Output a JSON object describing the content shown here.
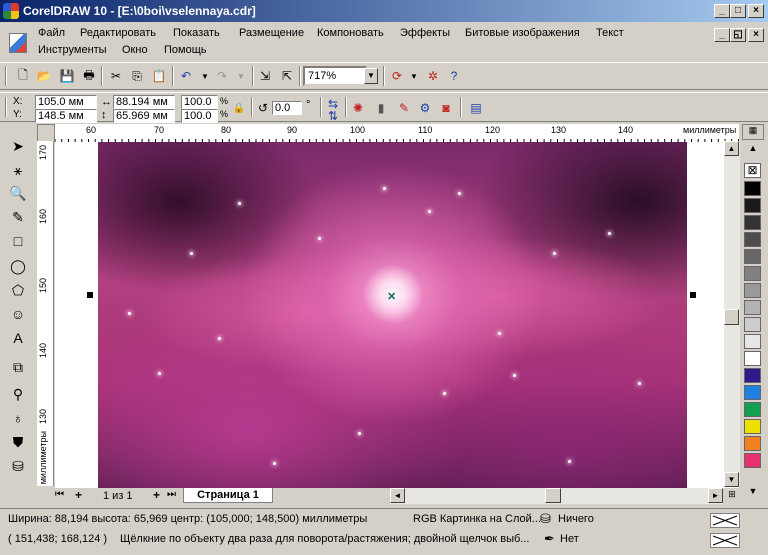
{
  "window": {
    "title": "CorelDRAW 10 - [E:\\0boi\\vselennaya.cdr]"
  },
  "menu": [
    {
      "label": "Файл"
    },
    {
      "label": "Редактировать"
    },
    {
      "label": "Показать"
    },
    {
      "label": "Размещение"
    },
    {
      "label": "Компоновать"
    },
    {
      "label": "Эффекты"
    },
    {
      "label": "Битовые изображения"
    },
    {
      "label": "Текст"
    },
    {
      "label": "Инструменты"
    },
    {
      "label": "Окно"
    },
    {
      "label": "Помощь"
    }
  ],
  "standard_toolbar": {
    "zoom": "717%"
  },
  "property_bar": {
    "x_label": "X:",
    "x": "105.0 мм",
    "y_label": "Y:",
    "y": "148.5 мм",
    "width": "88.194 мм",
    "height": "65.969 мм",
    "scale_x": "100.0",
    "scale_y": "100.0",
    "percent": "%",
    "angle": "0.0",
    "degree": "°"
  },
  "rulers": {
    "unit": "миллиметры",
    "h_ticks": [
      "60",
      "70",
      "80",
      "90",
      "100",
      "110",
      "120",
      "130",
      "140"
    ],
    "v_ticks": [
      "170",
      "160",
      "150",
      "140",
      "130"
    ],
    "v_unit": "миллиметры"
  },
  "page_nav": {
    "page_count": "1 из 1",
    "page_tab": "Страница 1"
  },
  "status": {
    "line1": "Ширина: 88,194  высота: 65,969  центр: (105,000; 148,500)  миллиметры",
    "object": "RGB Картинка на Слой...",
    "fill": "Ничего",
    "line2": "( 151,438; 168,124 )",
    "hint": "Щёлкние по объекту два раза для поворота/растяжения; двойной щелчок выб...",
    "outline": "Нет"
  },
  "colors": {
    "title_start": "#0a246a",
    "title_end": "#a6caf0",
    "palette": [
      "#000000",
      "#1a1a1a",
      "#333333",
      "#4d4d4d",
      "#666666",
      "#808080",
      "#999999",
      "#b3b3b3",
      "#cccccc",
      "#e6e6e6",
      "#ffffff",
      "#2e1a8a",
      "#2080e0",
      "#10a050",
      "#f0e000",
      "#f08020",
      "#e83070"
    ]
  }
}
